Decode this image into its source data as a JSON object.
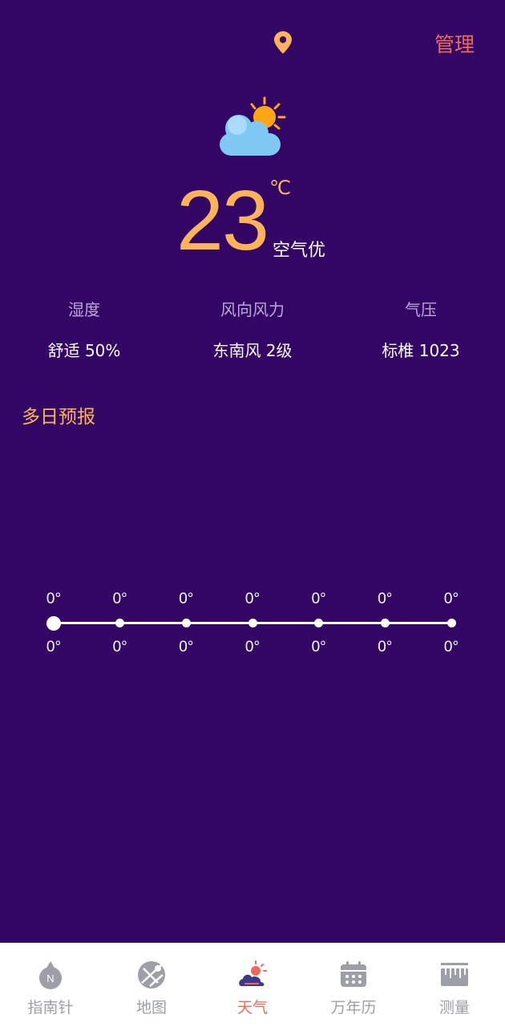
{
  "header": {
    "location_icon": "location-pin-icon",
    "manage_label": "管理"
  },
  "current": {
    "icon": "partly-cloudy-icon",
    "temperature": "23",
    "unit": "℃",
    "air_quality": "空气优"
  },
  "stats": [
    {
      "label": "湿度",
      "value": "舒适 50%"
    },
    {
      "label": "风向风力",
      "value": "东南风 2级"
    },
    {
      "label": "气压",
      "value": "标椎 1023"
    }
  ],
  "forecast": {
    "title": "多日预报",
    "highs": [
      "0°",
      "0°",
      "0°",
      "0°",
      "0°",
      "0°",
      "0°"
    ],
    "lows": [
      "0°",
      "0°",
      "0°",
      "0°",
      "0°",
      "0°",
      "0°"
    ],
    "selected_index": 0
  },
  "nav": {
    "active_index": 2,
    "items": [
      {
        "label": "指南针",
        "icon": "compass-icon"
      },
      {
        "label": "地图",
        "icon": "map-icon"
      },
      {
        "label": "天气",
        "icon": "weather-icon"
      },
      {
        "label": "万年历",
        "icon": "calendar-icon"
      },
      {
        "label": "测量",
        "icon": "ruler-icon"
      }
    ]
  },
  "colors": {
    "background": "#330565",
    "accent": "#FFB45A",
    "manage": "#F06A5A",
    "nav_active": "#F06A5A",
    "nav_inactive": "#9C9FA8"
  }
}
